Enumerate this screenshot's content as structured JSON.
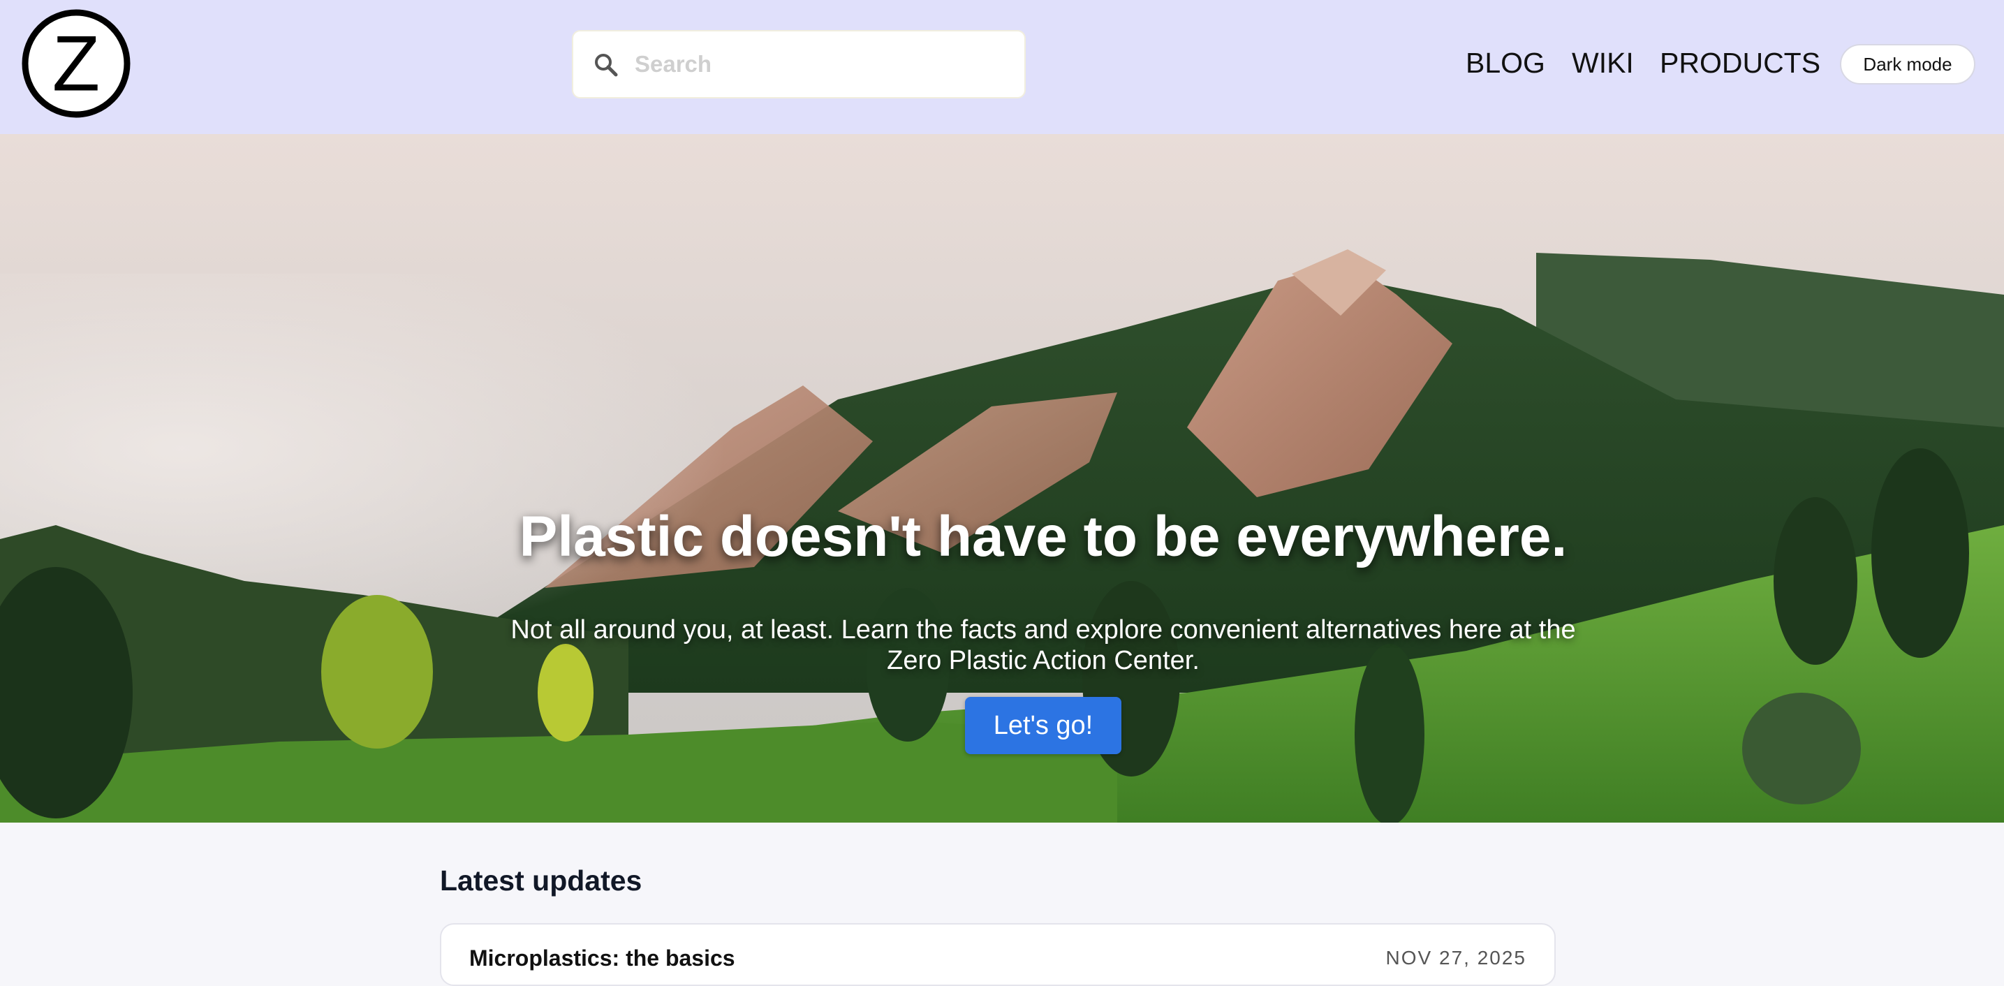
{
  "header": {
    "logo_letter": "Z",
    "search": {
      "placeholder": "Search",
      "value": ""
    },
    "nav": [
      {
        "label": "BLOG"
      },
      {
        "label": "WIKI"
      },
      {
        "label": "PRODUCTS"
      }
    ],
    "dark_mode_label": "Dark mode"
  },
  "hero": {
    "title": "Plastic doesn't have to be everywhere.",
    "subtitle": "Not all around you, at least. Learn the facts and explore convenient alternatives here at the Zero Plastic Action Center.",
    "cta_label": "Let's go!"
  },
  "updates": {
    "title": "Latest updates",
    "items": [
      {
        "title": "Microplastics: the basics",
        "date": "NOV 27, 2025"
      }
    ]
  },
  "colors": {
    "header_bg": "#e0e0fb",
    "accent": "#2c74e3",
    "page_bg": "#f6f6fa"
  },
  "icons": [
    "logo-z-icon",
    "search-icon"
  ]
}
